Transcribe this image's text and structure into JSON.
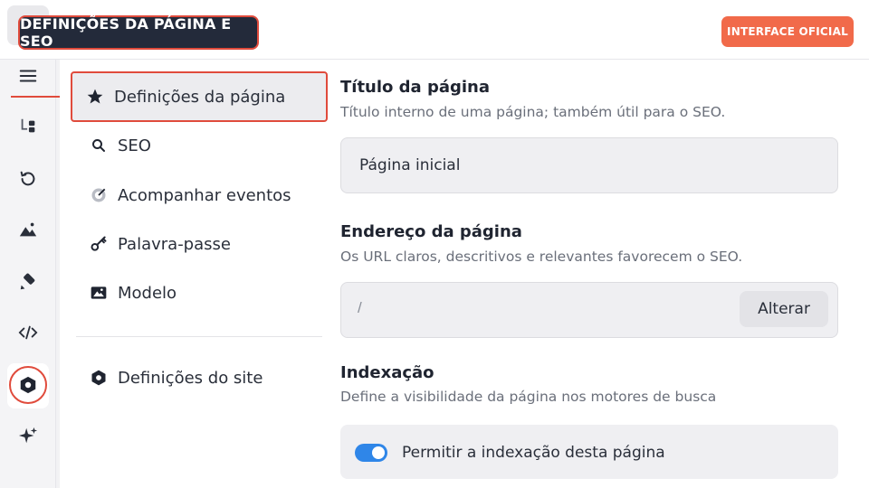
{
  "header": {
    "title": "DEFINIÇÕES DA PÁGINA E SEO",
    "official_button": "INTERFACE OFICIAL"
  },
  "rail": {
    "icons": [
      "menu-icon",
      "structure-icon",
      "history-icon",
      "image-icon",
      "brush-icon",
      "code-icon",
      "settings-hex-icon",
      "sparkle-icon"
    ],
    "active": "settings-hex-icon"
  },
  "nav": {
    "items": [
      {
        "label": "Definições da página",
        "icon": "star-icon",
        "selected": true
      },
      {
        "label": "SEO",
        "icon": "search-icon"
      },
      {
        "label": "Acompanhar eventos",
        "icon": "tracking-icon"
      },
      {
        "label": "Palavra-passe",
        "icon": "key-icon"
      },
      {
        "label": "Modelo",
        "icon": "template-icon"
      }
    ],
    "site_settings": {
      "label": "Definições do site",
      "icon": "hex-settings-icon"
    }
  },
  "main": {
    "title_section": {
      "heading": "Título da página",
      "description": "Título interno de uma página; também útil para o SEO.",
      "value": "Página inicial"
    },
    "address_section": {
      "heading": "Endereço da página",
      "description": "Os URL claros, descritivos e relevantes favorecem o SEO.",
      "value": "/",
      "button": "Alterar"
    },
    "indexing_section": {
      "heading": "Indexação",
      "description": "Define a visibilidade da página nos motores de busca",
      "toggle_label": "Permitir a indexação desta página",
      "toggle_on": true
    }
  },
  "colors": {
    "accent_red": "#e04b3c",
    "official_orange": "#f16a4a",
    "toggle_blue": "#2f86e8",
    "badge_dark": "#232a3a"
  }
}
